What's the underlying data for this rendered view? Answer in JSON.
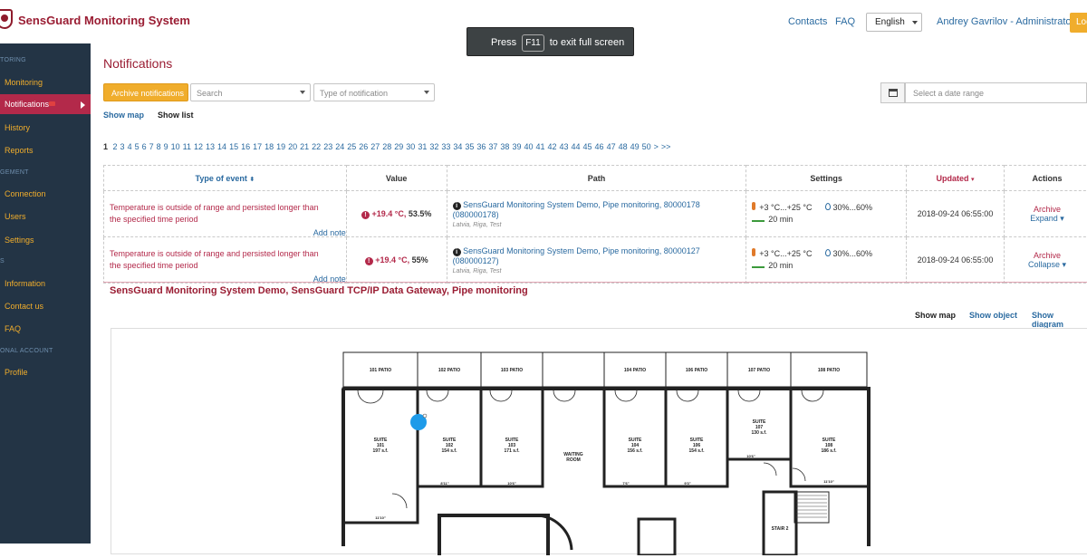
{
  "app": {
    "title": "SensGuard Monitoring System"
  },
  "header": {
    "contacts": "Contacts",
    "faq": "FAQ",
    "language": "English",
    "user": "Andrey Gavrilov - Administrator",
    "logout": "Log"
  },
  "fullscreen_toast": {
    "before": "Press",
    "key": "F11",
    "after": "to exit full screen"
  },
  "sidebar": {
    "sections": [
      "TORING",
      "GEMENT",
      "S",
      "ONAL ACCOUNT"
    ],
    "items": [
      "Monitoring",
      "Notifications",
      "History",
      "Reports",
      "Connection",
      "Users",
      "Settings",
      "Information",
      "Contact us",
      "FAQ",
      "Profile"
    ]
  },
  "main": {
    "title": "Notifications",
    "archive_button": "Archive notifications",
    "search_placeholder": "Search",
    "type_placeholder": "Type of notification",
    "date_placeholder": "Select a date range",
    "show_map": "Show map",
    "show_list": "Show list"
  },
  "pager": {
    "current": "1",
    "pages": [
      "2",
      "3",
      "4",
      "5",
      "6",
      "7",
      "8",
      "9",
      "10",
      "11",
      "12",
      "13",
      "14",
      "15",
      "16",
      "17",
      "18",
      "19",
      "20",
      "21",
      "22",
      "23",
      "24",
      "25",
      "26",
      "27",
      "28",
      "29",
      "30",
      "31",
      "32",
      "33",
      "34",
      "35",
      "36",
      "37",
      "38",
      "39",
      "40",
      "41",
      "42",
      "43",
      "44",
      "45",
      "46",
      "47",
      "48",
      "49",
      "50"
    ],
    "next": ">",
    "last": ">>"
  },
  "table": {
    "headers": [
      "Type of event",
      "Value",
      "Path",
      "Settings",
      "Updated",
      "Actions"
    ],
    "rows": [
      {
        "event": "Temperature is outside of range and persisted longer than the specified time period",
        "add_note": "Add note",
        "value_temp": "+19.4 °C,",
        "value_hum": "53.5%",
        "path": "SensGuard Monitoring System Demo, Pipe monitoring, 80000178 (080000178)",
        "location": "Latvia, Riga, Test",
        "temp_range": "+3 °C...+25 °C",
        "hum_range": "30%...60%",
        "duration": "20 min",
        "updated": "2018-09-24 06:55:00",
        "action1": "Archive",
        "action2": "Expand ▾"
      },
      {
        "event": "Temperature is outside of range and persisted longer than the specified time period",
        "add_note": "Add note",
        "value_temp": "+19.4 °C,",
        "value_hum": "55%",
        "path": "SensGuard Monitoring System Demo, Pipe monitoring, 80000127 (080000127)",
        "location": "Latvia, Riga, Test",
        "temp_range": "+3 °C...+25 °C",
        "hum_range": "30%...60%",
        "duration": "20 min",
        "updated": "2018-09-24 06:55:00",
        "action1": "Archive",
        "action2": "Collapse ▾"
      }
    ]
  },
  "group": {
    "title": "SensGuard Monitoring System Demo, SensGuard TCP/IP Data Gateway, Pipe monitoring",
    "tabs": [
      "Show map",
      "Show object",
      "Show diagram"
    ]
  },
  "floorplan": {
    "patios": [
      "101 PATIO",
      "102 PATIO",
      "103 PATIO",
      "104 PATIO",
      "106 PATIO",
      "107 PATIO",
      "108 PATIO"
    ],
    "suites": [
      {
        "name": "SUITE",
        "num": "101",
        "area": "197 s.f."
      },
      {
        "name": "SUITE",
        "num": "102",
        "area": "154 s.f."
      },
      {
        "name": "SUITE",
        "num": "103",
        "area": "171 s.f."
      },
      {
        "name": "SUITE",
        "num": "104",
        "area": "156 s.f."
      },
      {
        "name": "SUITE",
        "num": "106",
        "area": "154 s.f."
      },
      {
        "name": "SUITE",
        "num": "107",
        "area": "130 s.f."
      },
      {
        "name": "SUITE",
        "num": "108",
        "area": "186 s.f."
      }
    ],
    "waiting_room": [
      "WAITING",
      "ROOM"
    ],
    "stair": "STAIR 2",
    "dims": [
      "11'10\"",
      "8'11\"",
      "10'6\"",
      "7'6\"",
      "9'3\"",
      "10'6\"",
      "11'10\""
    ],
    "sensor_color": "#1e9be9"
  }
}
